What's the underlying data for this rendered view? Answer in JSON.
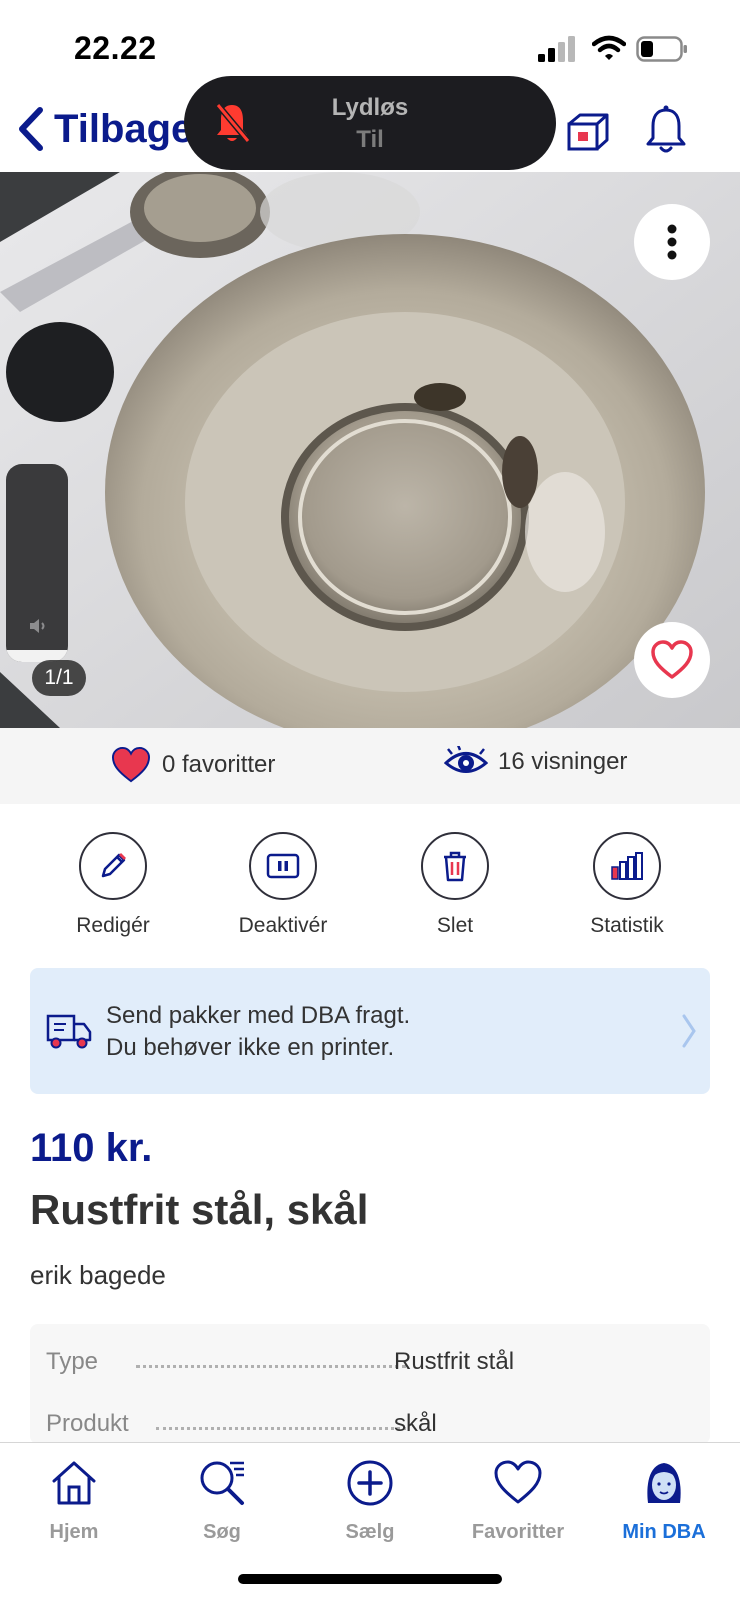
{
  "status_bar": {
    "time": "22.22",
    "battery_icon": "battery-icon",
    "wifi_icon": "wifi-icon",
    "signal_icon": "signal-icon"
  },
  "nav": {
    "back_label": "Tilbage",
    "back_icon": "chevron-left-icon",
    "box_icon": "package-icon",
    "bell_icon": "bell-icon",
    "accent": "#0b1b8c"
  },
  "silent_toast": {
    "title": "Lydløs",
    "subtitle": "Til",
    "icon": "bell-slash-icon",
    "icon_color": "#ff3b30"
  },
  "gallery": {
    "counter": "1/1",
    "more_icon": "more-vertical-icon",
    "favorite_icon": "heart-outline-icon",
    "volume_level": 0.06
  },
  "stats": {
    "favorites": "0 favoritter",
    "views": "16 visninger"
  },
  "actions": [
    {
      "label": "Redigér",
      "icon": "pencil-icon"
    },
    {
      "label": "Deaktivér",
      "icon": "pause-icon"
    },
    {
      "label": "Slet",
      "icon": "trash-icon"
    },
    {
      "label": "Statistik",
      "icon": "bar-chart-icon"
    }
  ],
  "shipping": {
    "line1": "Send pakker med DBA fragt.",
    "line2": "Du behøver ikke en printer.",
    "icon": "delivery-truck-icon",
    "background": "#e1edfa"
  },
  "listing": {
    "price": "110 kr.",
    "title": "Rustfrit stål, skål",
    "seller": "erik bagede"
  },
  "attributes": [
    {
      "key": "Type",
      "value": "Rustfrit stål"
    },
    {
      "key": "Produkt",
      "value": "skål"
    }
  ],
  "tabbar": {
    "active_color": "#1b6fd9",
    "items": [
      {
        "label": "Hjem",
        "icon": "home-icon"
      },
      {
        "label": "Søg",
        "icon": "search-icon"
      },
      {
        "label": "Sælg",
        "icon": "plus-circle-icon"
      },
      {
        "label": "Favoritter",
        "icon": "heart-icon"
      },
      {
        "label": "Min DBA",
        "icon": "profile-avatar-icon",
        "active": true
      }
    ]
  }
}
